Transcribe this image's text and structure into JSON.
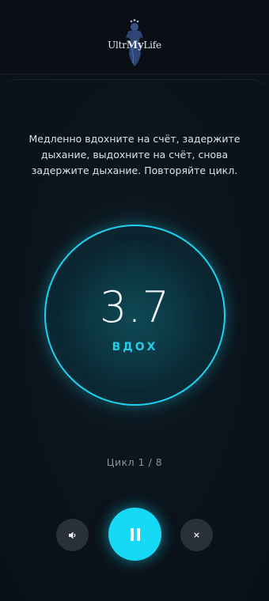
{
  "header": {
    "logo_text_part1": "Ultr",
    "logo_text_part2": "My",
    "logo_text_part3": "Life"
  },
  "exercise": {
    "instructions": "Медленно вдохните на счёт, задержите дыхание, выдохните на счёт, снова задержите дыхание. Повторяйте цикл.",
    "timer_value": "3.7",
    "phase_label": "ВДОХ",
    "cycle_text": "Цикл 1 / 8"
  },
  "controls": {
    "sound_icon": "speaker-icon",
    "pause_icon": "pause-icon",
    "close_icon": "close-icon",
    "close_glyph": "×"
  },
  "colors": {
    "accent": "#15d9f5",
    "ring": "#1fd3f0",
    "background": "#0b1118"
  }
}
